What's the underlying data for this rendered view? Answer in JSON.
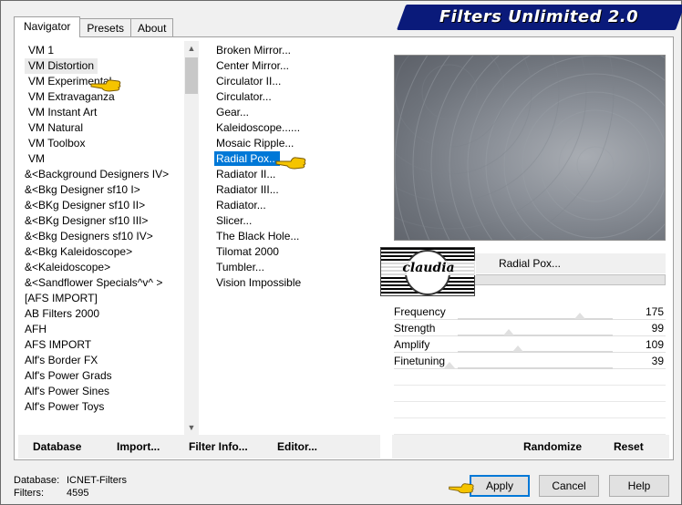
{
  "window": {
    "title": "Filters Unlimited 2.0"
  },
  "tabs": [
    {
      "label": "Navigator",
      "active": true
    },
    {
      "label": "Presets",
      "active": false
    },
    {
      "label": "About",
      "active": false
    }
  ],
  "categories": [
    "VM 1",
    "VM Distortion",
    "VM Experimental",
    "VM Extravaganza",
    "VM Instant Art",
    "VM Natural",
    "VM Toolbox",
    "VM",
    "&<Background Designers IV>",
    "&<Bkg Designer sf10 I>",
    "&<BKg Designer sf10 II>",
    "&<BKg Designer sf10 III>",
    "&<Bkg Designers sf10 IV>",
    "&<Bkg Kaleidoscope>",
    "&<Kaleidoscope>",
    "&<Sandflower Specials^v^ >",
    "[AFS IMPORT]",
    "AB Filters 2000",
    "AFH",
    "AFS IMPORT",
    "Alf's Border FX",
    "Alf's Power Grads",
    "Alf's Power Sines",
    "Alf's Power Toys"
  ],
  "selected_category": "VM Distortion",
  "filters": [
    "Broken Mirror...",
    "Center Mirror...",
    "Circulator II...",
    "Circulator...",
    "Gear...",
    "Kaleidoscope......",
    "Mosaic Ripple...",
    "Radial Pox...",
    "Radiator II...",
    "Radiator III...",
    "Radiator...",
    "Slicer...",
    "The Black Hole...",
    "Tilomat 2000",
    "Tumbler...",
    "Vision Impossible"
  ],
  "selected_filter": "Radial Pox...",
  "preview": {
    "filter_name": "Radial Pox...",
    "watermark": "claudia"
  },
  "params": [
    {
      "label": "Frequency",
      "value": 175
    },
    {
      "label": "Strength",
      "value": 99
    },
    {
      "label": "Amplify",
      "value": 109
    },
    {
      "label": "Finetuning",
      "value": 39
    }
  ],
  "left_buttons": {
    "database": "Database",
    "import": "Import...",
    "filter_info": "Filter Info...",
    "editor": "Editor..."
  },
  "right_buttons": {
    "randomize": "Randomize",
    "reset": "Reset"
  },
  "status": {
    "database_label": "Database:",
    "database_value": "ICNET-Filters",
    "filters_label": "Filters:",
    "filters_value": "4595"
  },
  "dialog_buttons": {
    "apply": "Apply",
    "cancel": "Cancel",
    "help": "Help"
  },
  "colors": {
    "banner": "#0a1a7a",
    "selection": "#0078d7",
    "pointer": "#f5c400"
  }
}
